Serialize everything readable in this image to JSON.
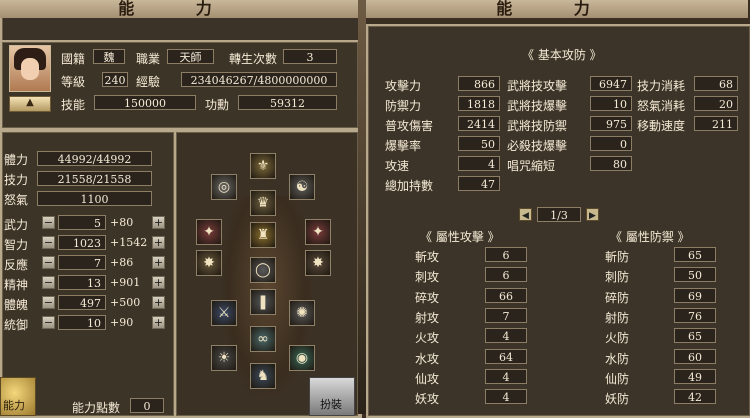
{
  "left_title": "能 力",
  "right_title": "能 力",
  "profile": {
    "nationality_label": "國籍",
    "nationality": "魏",
    "job_label": "職業",
    "job": "天師",
    "rebirth_label": "轉生次數",
    "rebirth": "3",
    "level_label": "等級",
    "level": "240",
    "exp_label": "經驗",
    "exp": "234046267/4800000000",
    "skill_label": "技能",
    "skill": "150000",
    "merit_label": "功勳",
    "merit": "59312"
  },
  "vitals": [
    {
      "label": "體力",
      "value": "44992/44992"
    },
    {
      "label": "技力",
      "value": "21558/21558"
    },
    {
      "label": "怒氣",
      "value": "1100"
    }
  ],
  "attributes": [
    {
      "label": "武力",
      "value": "5",
      "bonus": "+80"
    },
    {
      "label": "智力",
      "value": "1023",
      "bonus": "+1542"
    },
    {
      "label": "反應",
      "value": "7",
      "bonus": "+86"
    },
    {
      "label": "精神",
      "value": "13",
      "bonus": "+901"
    },
    {
      "label": "體魄",
      "value": "497",
      "bonus": "+500"
    },
    {
      "label": "統御",
      "value": "10",
      "bonus": "+90"
    }
  ],
  "points_label": "能力點數",
  "points": "0",
  "basic": {
    "header": "《 基本攻防 》",
    "col1": [
      {
        "label": "攻擊力",
        "value": "866"
      },
      {
        "label": "防禦力",
        "value": "1818"
      },
      {
        "label": "普攻傷害",
        "value": "2414"
      },
      {
        "label": "爆擊率",
        "value": "50"
      },
      {
        "label": "攻速",
        "value": "4"
      },
      {
        "label": "總加持數",
        "value": "47"
      }
    ],
    "col2": [
      {
        "label": "武將技攻擊",
        "value": "6947"
      },
      {
        "label": "武將技爆擊",
        "value": "10"
      },
      {
        "label": "武將技防禦",
        "value": "975"
      },
      {
        "label": "必殺技爆擊",
        "value": "0"
      },
      {
        "label": "唱咒縮短",
        "value": "80"
      }
    ],
    "col3": [
      {
        "label": "技力消耗",
        "value": "68"
      },
      {
        "label": "怒氣消耗",
        "value": "20"
      },
      {
        "label": "移動速度",
        "value": "211"
      }
    ]
  },
  "pager": {
    "text": "1/3"
  },
  "attack_header": "《 屬性攻擊 》",
  "defense_header": "《 屬性防禦 》",
  "elem_attack": [
    {
      "label": "斬攻",
      "value": "6"
    },
    {
      "label": "刺攻",
      "value": "6"
    },
    {
      "label": "碎攻",
      "value": "66"
    },
    {
      "label": "射攻",
      "value": "7"
    },
    {
      "label": "火攻",
      "value": "4"
    },
    {
      "label": "水攻",
      "value": "64"
    },
    {
      "label": "仙攻",
      "value": "4"
    },
    {
      "label": "妖攻",
      "value": "4"
    }
  ],
  "elem_defense": [
    {
      "label": "斬防",
      "value": "65"
    },
    {
      "label": "刺防",
      "value": "50"
    },
    {
      "label": "碎防",
      "value": "69"
    },
    {
      "label": "射防",
      "value": "76"
    },
    {
      "label": "火防",
      "value": "65"
    },
    {
      "label": "水防",
      "value": "60"
    },
    {
      "label": "仙防",
      "value": "49"
    },
    {
      "label": "妖防",
      "value": "42"
    }
  ],
  "corner_left_label": "能力",
  "corner_right_label": "扮裝"
}
